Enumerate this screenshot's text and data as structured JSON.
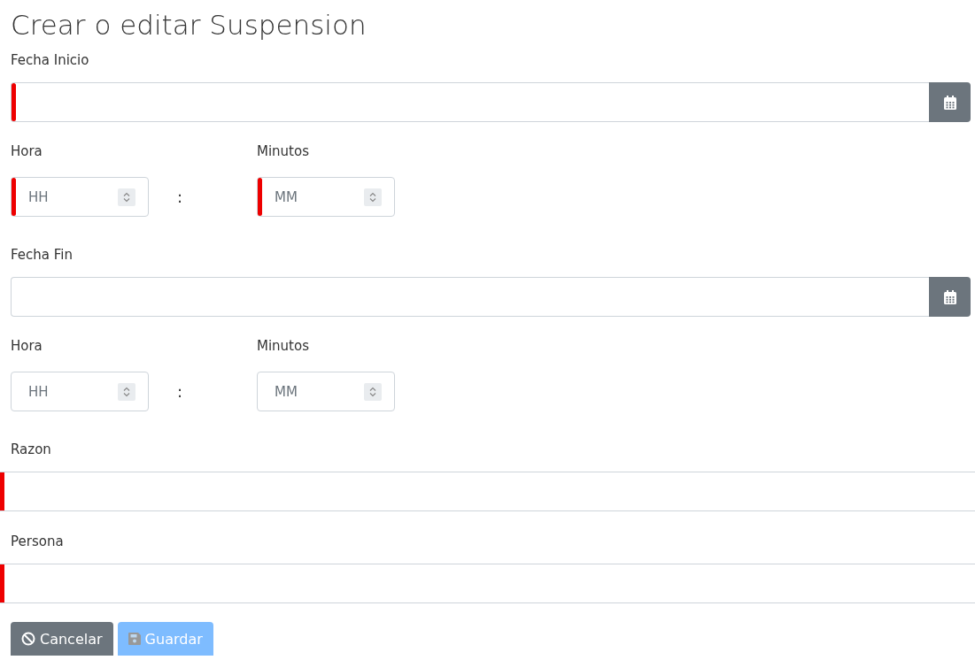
{
  "title": "Crear o editar Suspension",
  "date_fields": [
    {
      "label": "Fecha Inicio",
      "required": true,
      "hour": {
        "label": "Hora",
        "placeholder": "HH",
        "required": true
      },
      "separator": ":",
      "minute": {
        "label": "Minutos",
        "placeholder": "MM",
        "required": true
      }
    },
    {
      "label": "Fecha Fin",
      "required": false,
      "hour": {
        "label": "Hora",
        "placeholder": "HH",
        "required": false
      },
      "separator": ":",
      "minute": {
        "label": "Minutos",
        "placeholder": "MM",
        "required": false
      }
    }
  ],
  "text_fields": [
    {
      "label": "Razon",
      "required": true
    },
    {
      "label": "Persona",
      "required": true
    }
  ],
  "buttons": [
    {
      "label": "Cancelar",
      "kind": "cancel",
      "disabled": false
    },
    {
      "label": "Guardar",
      "kind": "save",
      "disabled": true
    }
  ]
}
